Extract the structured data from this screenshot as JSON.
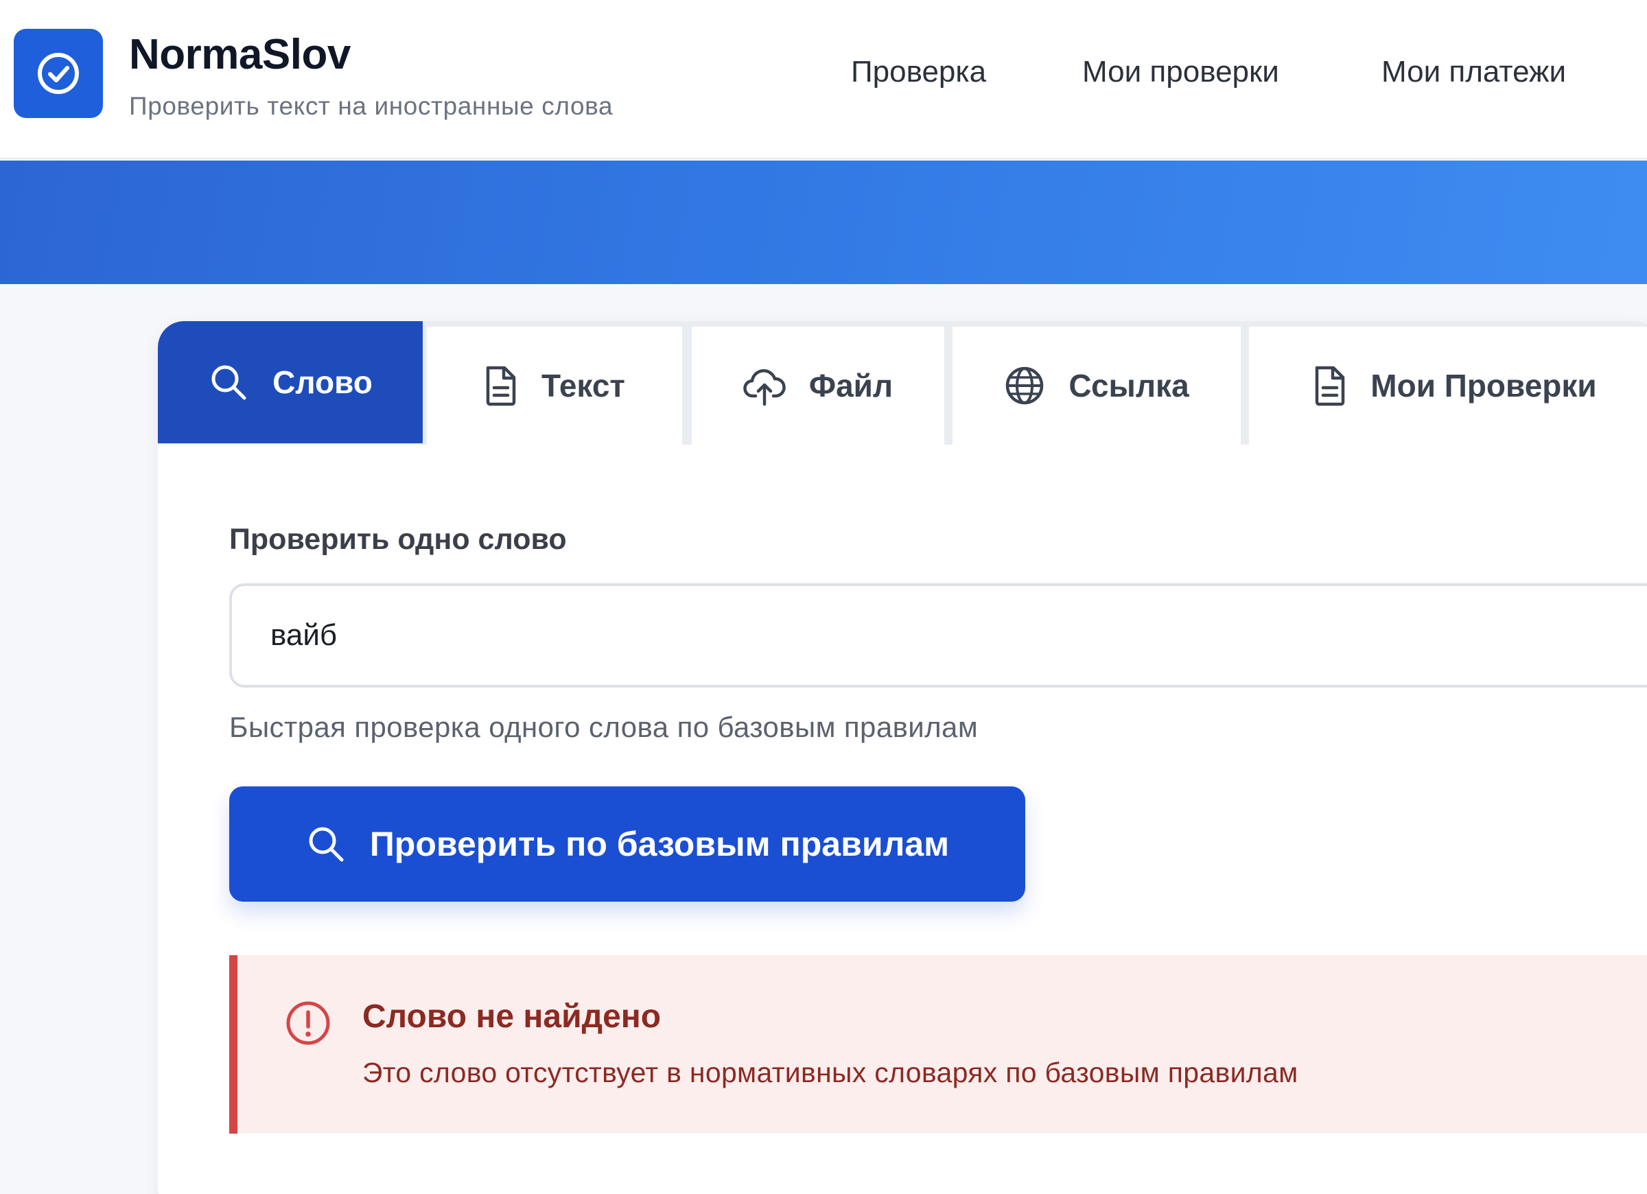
{
  "brand": {
    "name": "NormaSlov",
    "subtitle": "Проверить текст на иностранные слова",
    "logo_icon": "check-circle-icon",
    "accent_color": "#1f5fdc"
  },
  "nav": {
    "items": [
      {
        "label": "Проверка"
      },
      {
        "label": "Мои проверки"
      },
      {
        "label": "Мои платежи"
      }
    ]
  },
  "tabs": [
    {
      "label": "Слово",
      "icon": "search-icon",
      "active": true
    },
    {
      "label": "Текст",
      "icon": "document-icon",
      "active": false
    },
    {
      "label": "Файл",
      "icon": "upload-cloud-icon",
      "active": false
    },
    {
      "label": "Ссылка",
      "icon": "globe-icon",
      "active": false
    },
    {
      "label": "Мои Проверки",
      "icon": "document-icon",
      "active": false
    }
  ],
  "form": {
    "label": "Проверить одно слово",
    "input_value": "вайб",
    "hint": "Быстрая проверка одного слова по базовым правилам",
    "button_label": "Проверить по базовым правилам",
    "button_icon": "search-icon",
    "button_color": "#1b4fd3"
  },
  "alert": {
    "icon": "exclamation-circle-icon",
    "title": "Слово не найдено",
    "message": "Это слово отсутствует в нормативных словарях по базовым правилам",
    "color": "#d64545"
  }
}
